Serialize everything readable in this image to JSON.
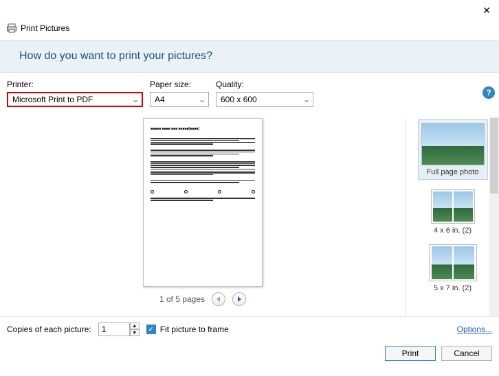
{
  "window": {
    "title": "Print Pictures"
  },
  "prompt": "How do you want to print your pictures?",
  "controls": {
    "printer": {
      "label": "Printer:",
      "value": "Microsoft Print to PDF"
    },
    "paper": {
      "label": "Paper size:",
      "value": "A4"
    },
    "quality": {
      "label": "Quality:",
      "value": "600 x 600"
    },
    "help_glyph": "?"
  },
  "preview": {
    "page_counter": "1 of 5 pages"
  },
  "layouts": {
    "full": "Full page photo",
    "four_by_six": "4 x 6 in. (2)",
    "five_by_seven": "5 x 7 in. (2)"
  },
  "bottom": {
    "copies_label": "Copies of each picture:",
    "copies_value": "1",
    "fit_label": "Fit picture to frame",
    "fit_check": "✓",
    "options_link": "Options..."
  },
  "actions": {
    "print": "Print",
    "cancel": "Cancel"
  }
}
